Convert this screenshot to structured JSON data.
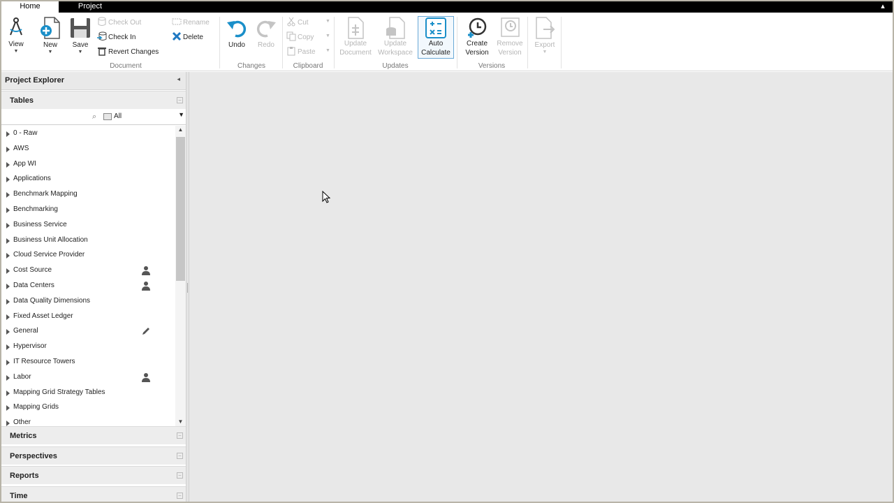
{
  "tabs": [
    {
      "label": "Home",
      "active": true
    },
    {
      "label": "Project",
      "active": false
    }
  ],
  "ribbon": {
    "view": "View",
    "new": "New",
    "save": "Save",
    "check_out": "Check Out",
    "check_in": "Check In",
    "revert_changes": "Revert Changes",
    "rename": "Rename",
    "delete": "Delete",
    "undo": "Undo",
    "redo": "Redo",
    "cut": "Cut",
    "copy": "Copy",
    "paste": "Paste",
    "update_document": [
      "Update",
      "Document"
    ],
    "update_workspace": [
      "Update",
      "Workspace"
    ],
    "auto_calculate": [
      "Auto",
      "Calculate"
    ],
    "create_version": [
      "Create",
      "Version"
    ],
    "remove_version": [
      "Remove",
      "Version"
    ],
    "export": "Export",
    "groups": {
      "document": "Document",
      "changes": "Changes",
      "clipboard": "Clipboard",
      "updates": "Updates",
      "versions": "Versions"
    }
  },
  "panel": {
    "title": "Project Explorer",
    "tables_section": "Tables",
    "filter_value": "All",
    "tree_items": [
      {
        "label": "0 - Raw",
        "icon": ""
      },
      {
        "label": "AWS",
        "icon": ""
      },
      {
        "label": "App WI",
        "icon": ""
      },
      {
        "label": "Applications",
        "icon": ""
      },
      {
        "label": "Benchmark Mapping",
        "icon": ""
      },
      {
        "label": "Benchmarking",
        "icon": ""
      },
      {
        "label": "Business Service",
        "icon": ""
      },
      {
        "label": "Business Unit Allocation",
        "icon": ""
      },
      {
        "label": "Cloud Service Provider",
        "icon": ""
      },
      {
        "label": "Cost Source",
        "icon": "user-icon"
      },
      {
        "label": "Data Centers",
        "icon": "user-icon"
      },
      {
        "label": "Data Quality Dimensions",
        "icon": ""
      },
      {
        "label": "Fixed Asset Ledger",
        "icon": ""
      },
      {
        "label": "General",
        "icon": "pencil-icon"
      },
      {
        "label": "Hypervisor",
        "icon": ""
      },
      {
        "label": "IT Resource Towers",
        "icon": ""
      },
      {
        "label": "Labor",
        "icon": "user-icon"
      },
      {
        "label": "Mapping Grid Strategy Tables",
        "icon": ""
      },
      {
        "label": "Mapping Grids",
        "icon": ""
      },
      {
        "label": "Other",
        "icon": ""
      }
    ],
    "sections": [
      "Metrics",
      "Perspectives",
      "Reports",
      "Time"
    ]
  },
  "colors": {
    "accent": "#1a8fc9",
    "delete_red": "#1e78c2",
    "tabbar": "#000000",
    "workspace": "#e8e8e8"
  }
}
